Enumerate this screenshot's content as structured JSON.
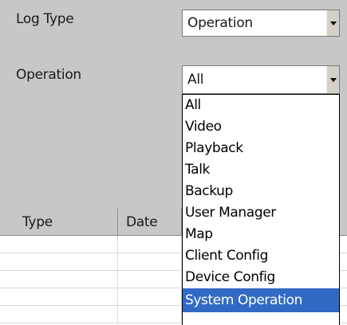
{
  "filters": {
    "log_type": {
      "label": "Log Type",
      "value": "Operation"
    },
    "operation": {
      "label": "Operation",
      "value": "All",
      "options": [
        "All",
        "Video",
        "Playback",
        "Talk",
        "Backup",
        "User Manager",
        "Map",
        "Client Config",
        "Device Config",
        "System Operation"
      ],
      "highlighted_option": "System Operation"
    }
  },
  "table": {
    "columns": [
      "Type",
      "Date"
    ]
  },
  "colors": {
    "panel_bg": "#c7c7c7",
    "selection_bg": "#316ac5",
    "selection_text": "#ffffff"
  }
}
